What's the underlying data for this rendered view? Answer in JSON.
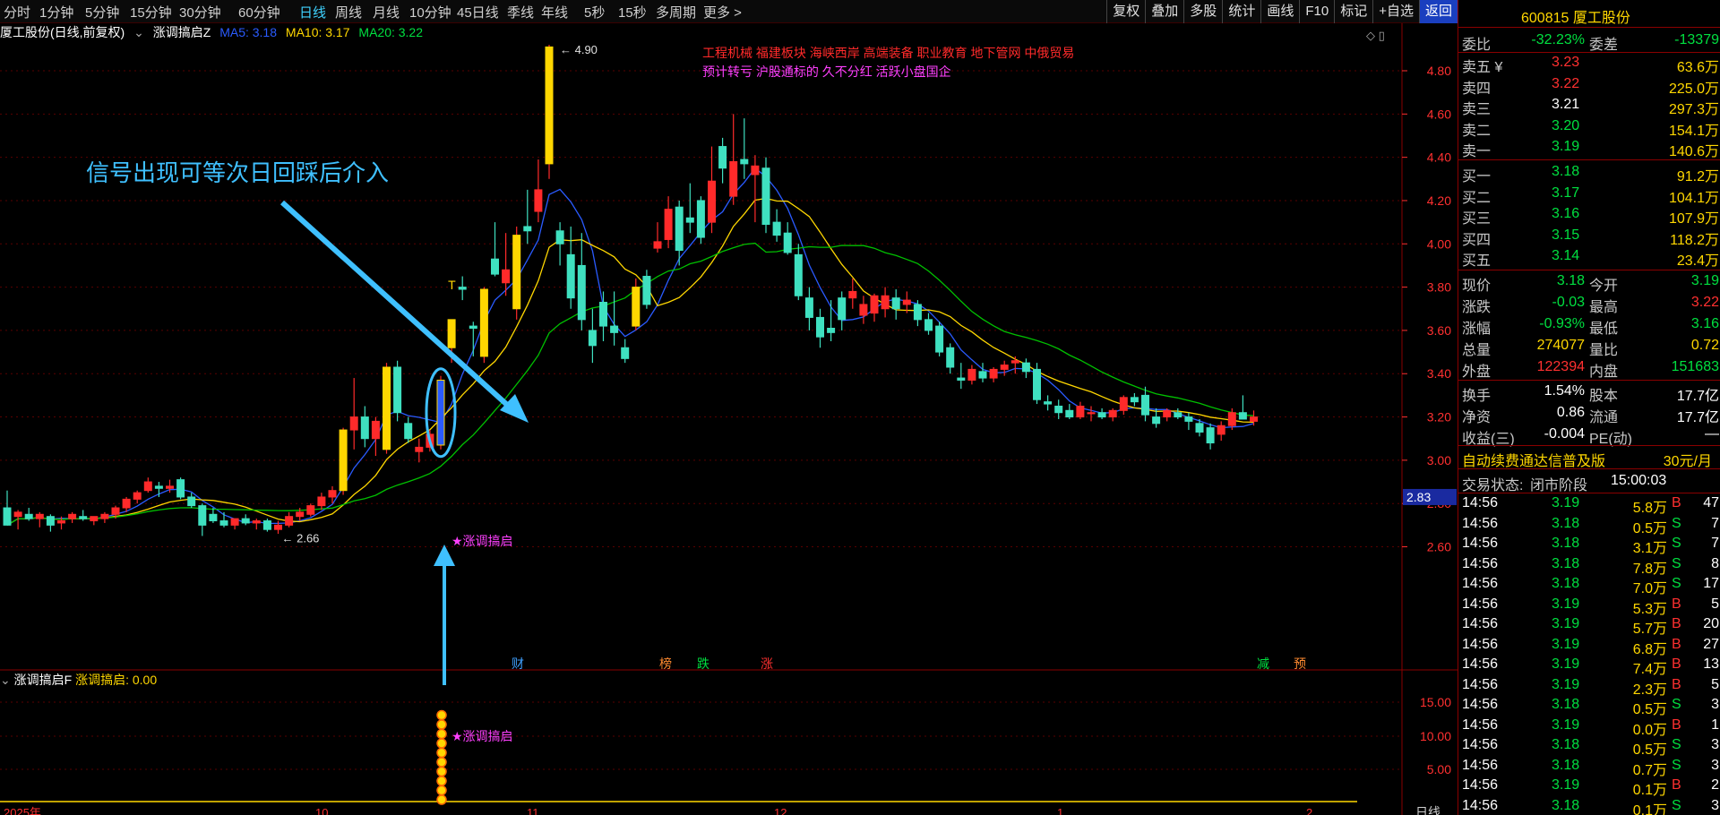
{
  "toolbar": {
    "periods": [
      "分时",
      "1分钟",
      "5分钟",
      "15分钟",
      "30分钟",
      "60分钟",
      "日线",
      "周线",
      "月线",
      "10分钟",
      "45日线",
      "季线",
      "年线",
      "5秒",
      "15秒",
      "多周期",
      "更多 >"
    ],
    "active_period": "日线",
    "tools": [
      "复权",
      "叠加",
      "多股",
      "统计",
      "画线",
      "F10",
      "标记",
      "+自选",
      "返回"
    ]
  },
  "chart": {
    "header": {
      "title": "厦工股份(日线,前复权)",
      "indicator": "涨调搞启Z",
      "ma5": "MA5: 3.18",
      "ma10": "MA10: 3.17",
      "ma20": "MA20: 3.22"
    },
    "annotation": "信号出现可等次日回踩后介入",
    "signal_label": "★涨调搞启",
    "max_label": "4.90",
    "min_label": "2.66",
    "concepts_line1": "工程机械   福建板块   海峡西岸 高端装备 职业教育 地下管网 中俄贸易",
    "concepts_line2": "预计转亏 沪股通标的 久不分红 活跃小盘国企",
    "markers": [
      "财",
      "榜",
      "跌",
      "涨",
      "减",
      "预"
    ],
    "current_price_tag": "2.83",
    "t_mark": "T",
    "x_labels": [
      "2025年",
      "10",
      "11",
      "12",
      "1",
      "2"
    ],
    "period_tag": "日线",
    "sub": {
      "title": "涨调搞启F",
      "value": "涨调搞启: 0.00",
      "signal_label": "★涨调搞启",
      "y_ticks": [
        "15.00",
        "10.00",
        "5.00"
      ]
    }
  },
  "chart_data": {
    "type": "candlestick",
    "y_ticks": [
      "4.80",
      "4.60",
      "4.40",
      "4.20",
      "4.00",
      "3.80",
      "3.60",
      "3.40",
      "3.20",
      "3.00",
      "2.80",
      "2.60"
    ],
    "ylim": [
      2.52,
      4.95
    ],
    "candles": [
      [
        2.78,
        2.86,
        2.7,
        2.7
      ],
      [
        2.74,
        2.77,
        2.68,
        2.76
      ],
      [
        2.75,
        2.78,
        2.72,
        2.73
      ],
      [
        2.73,
        2.76,
        2.69,
        2.75
      ],
      [
        2.74,
        2.75,
        2.67,
        2.7
      ],
      [
        2.71,
        2.74,
        2.68,
        2.72
      ],
      [
        2.73,
        2.76,
        2.71,
        2.75
      ],
      [
        2.74,
        2.77,
        2.72,
        2.73
      ],
      [
        2.72,
        2.74,
        2.7,
        2.74
      ],
      [
        2.73,
        2.76,
        2.71,
        2.75
      ],
      [
        2.75,
        2.79,
        2.73,
        2.78
      ],
      [
        2.78,
        2.83,
        2.76,
        2.82
      ],
      [
        2.82,
        2.86,
        2.8,
        2.85
      ],
      [
        2.86,
        2.92,
        2.85,
        2.9
      ],
      [
        2.88,
        2.9,
        2.83,
        2.87
      ],
      [
        2.87,
        2.91,
        2.85,
        2.88
      ],
      [
        2.91,
        2.92,
        2.82,
        2.83
      ],
      [
        2.83,
        2.85,
        2.78,
        2.79
      ],
      [
        2.79,
        2.8,
        2.65,
        2.7
      ],
      [
        2.75,
        2.78,
        2.71,
        2.72
      ],
      [
        2.72,
        2.76,
        2.69,
        2.7
      ],
      [
        2.7,
        2.73,
        2.68,
        2.73
      ],
      [
        2.73,
        2.75,
        2.7,
        2.71
      ],
      [
        2.71,
        2.73,
        2.68,
        2.72
      ],
      [
        2.72,
        2.73,
        2.67,
        2.68
      ],
      [
        2.68,
        2.72,
        2.66,
        2.7
      ],
      [
        2.7,
        2.76,
        2.69,
        2.74
      ],
      [
        2.74,
        2.78,
        2.72,
        2.76
      ],
      [
        2.75,
        2.8,
        2.74,
        2.79
      ],
      [
        2.79,
        2.85,
        2.77,
        2.83
      ],
      [
        2.83,
        2.88,
        2.8,
        2.86
      ],
      [
        2.86,
        3.15,
        2.84,
        3.14
      ],
      [
        3.14,
        3.38,
        3.05,
        3.2
      ],
      [
        3.2,
        3.25,
        3.06,
        3.1
      ],
      [
        3.1,
        3.2,
        3.02,
        3.18
      ],
      [
        3.05,
        3.45,
        3.03,
        3.43
      ],
      [
        3.43,
        3.46,
        3.18,
        3.22
      ],
      [
        3.17,
        3.2,
        3.08,
        3.1
      ],
      [
        3.04,
        3.1,
        2.99,
        3.06
      ],
      [
        3.06,
        3.14,
        3.04,
        3.12
      ],
      [
        3.07,
        3.39,
        3.05,
        3.37
      ],
      [
        3.52,
        3.62,
        3.45,
        3.65
      ],
      [
        3.8,
        3.85,
        3.74,
        3.79
      ],
      [
        3.62,
        3.64,
        3.48,
        3.61
      ],
      [
        3.48,
        3.8,
        3.45,
        3.79
      ],
      [
        3.93,
        4.1,
        3.85,
        3.86
      ],
      [
        3.82,
        4.05,
        3.76,
        3.88
      ],
      [
        3.7,
        4.08,
        3.65,
        4.04
      ],
      [
        4.08,
        4.25,
        4.0,
        4.06
      ],
      [
        4.15,
        4.39,
        4.1,
        4.25
      ],
      [
        4.37,
        4.92,
        4.3,
        4.91
      ],
      [
        4.06,
        4.1,
        3.9,
        4.0
      ],
      [
        3.95,
        4.08,
        3.7,
        3.75
      ],
      [
        3.9,
        4.05,
        3.6,
        3.65
      ],
      [
        3.6,
        3.7,
        3.45,
        3.53
      ],
      [
        3.73,
        3.78,
        3.55,
        3.62
      ],
      [
        3.62,
        3.78,
        3.53,
        3.59
      ],
      [
        3.52,
        3.56,
        3.45,
        3.47
      ],
      [
        3.62,
        3.84,
        3.6,
        3.8
      ],
      [
        3.85,
        3.88,
        3.7,
        3.72
      ],
      [
        3.98,
        4.1,
        3.96,
        4.01
      ],
      [
        4.02,
        4.22,
        3.98,
        4.16
      ],
      [
        4.17,
        4.2,
        3.9,
        3.97
      ],
      [
        4.12,
        4.28,
        4.05,
        4.1
      ],
      [
        4.2,
        4.22,
        4.0,
        4.03
      ],
      [
        4.1,
        4.45,
        4.05,
        4.29
      ],
      [
        4.45,
        4.49,
        4.28,
        4.35
      ],
      [
        4.22,
        4.6,
        4.18,
        4.38
      ],
      [
        4.39,
        4.58,
        4.3,
        4.37
      ],
      [
        4.32,
        4.41,
        4.1,
        4.36
      ],
      [
        4.35,
        4.4,
        4.05,
        4.09
      ],
      [
        4.1,
        4.16,
        4.01,
        4.04
      ],
      [
        4.05,
        4.1,
        3.95,
        3.96
      ],
      [
        3.95,
        4.0,
        3.74,
        3.76
      ],
      [
        3.75,
        3.8,
        3.6,
        3.66
      ],
      [
        3.66,
        3.7,
        3.52,
        3.57
      ],
      [
        3.61,
        3.74,
        3.55,
        3.59
      ],
      [
        3.75,
        3.78,
        3.6,
        3.65
      ],
      [
        3.75,
        3.84,
        3.7,
        3.78
      ],
      [
        3.67,
        3.76,
        3.63,
        3.72
      ],
      [
        3.68,
        3.77,
        3.64,
        3.76
      ],
      [
        3.7,
        3.8,
        3.66,
        3.76
      ],
      [
        3.75,
        3.79,
        3.65,
        3.7
      ],
      [
        3.72,
        3.78,
        3.68,
        3.74
      ],
      [
        3.72,
        3.74,
        3.62,
        3.65
      ],
      [
        3.65,
        3.68,
        3.58,
        3.6
      ],
      [
        3.62,
        3.64,
        3.48,
        3.5
      ],
      [
        3.52,
        3.54,
        3.4,
        3.43
      ],
      [
        3.38,
        3.45,
        3.33,
        3.37
      ],
      [
        3.37,
        3.44,
        3.35,
        3.42
      ],
      [
        3.41,
        3.45,
        3.36,
        3.38
      ],
      [
        3.38,
        3.43,
        3.36,
        3.42
      ],
      [
        3.42,
        3.46,
        3.39,
        3.44
      ],
      [
        3.45,
        3.48,
        3.4,
        3.46
      ],
      [
        3.45,
        3.47,
        3.38,
        3.41
      ],
      [
        3.42,
        3.45,
        3.26,
        3.28
      ],
      [
        3.27,
        3.3,
        3.23,
        3.26
      ],
      [
        3.25,
        3.28,
        3.19,
        3.22
      ],
      [
        3.23,
        3.26,
        3.19,
        3.2
      ],
      [
        3.2,
        3.27,
        3.19,
        3.25
      ],
      [
        3.22,
        3.25,
        3.18,
        3.22
      ],
      [
        3.22,
        3.24,
        3.19,
        3.2
      ],
      [
        3.2,
        3.24,
        3.18,
        3.23
      ],
      [
        3.23,
        3.3,
        3.21,
        3.29
      ],
      [
        3.29,
        3.31,
        3.25,
        3.27
      ],
      [
        3.3,
        3.34,
        3.18,
        3.21
      ],
      [
        3.2,
        3.24,
        3.15,
        3.17
      ],
      [
        3.2,
        3.24,
        3.18,
        3.23
      ],
      [
        3.22,
        3.24,
        3.19,
        3.2
      ],
      [
        3.2,
        3.22,
        3.14,
        3.18
      ],
      [
        3.17,
        3.19,
        3.11,
        3.13
      ],
      [
        3.15,
        3.17,
        3.05,
        3.08
      ],
      [
        3.12,
        3.18,
        3.09,
        3.16
      ],
      [
        3.16,
        3.24,
        3.14,
        3.22
      ],
      [
        3.22,
        3.3,
        3.19,
        3.19
      ],
      [
        3.18,
        3.23,
        3.16,
        3.2
      ]
    ]
  },
  "quote": {
    "code": "600815",
    "name": "厦工股份",
    "weibi_label": "委比",
    "weibi": "-32.23%",
    "weicha_label": "委差",
    "weicha": "-13379",
    "sell": [
      {
        "label": "卖五 ¥",
        "price": "3.23",
        "vol": "63.6万"
      },
      {
        "label": "卖四",
        "price": "3.22",
        "vol": "225.0万"
      },
      {
        "label": "卖三",
        "price": "3.21",
        "vol": "297.3万"
      },
      {
        "label": "卖二",
        "price": "3.20",
        "vol": "154.1万"
      },
      {
        "label": "卖一",
        "price": "3.19",
        "vol": "140.6万"
      }
    ],
    "buy": [
      {
        "label": "买一",
        "price": "3.18",
        "vol": "91.2万"
      },
      {
        "label": "买二",
        "price": "3.17",
        "vol": "104.1万"
      },
      {
        "label": "买三",
        "price": "3.16",
        "vol": "107.9万"
      },
      {
        "label": "买四",
        "price": "3.15",
        "vol": "118.2万"
      },
      {
        "label": "买五",
        "price": "3.14",
        "vol": "23.4万"
      }
    ],
    "stats": [
      {
        "l1": "现价",
        "v1": "3.18",
        "l2": "今开",
        "v2": "3.19"
      },
      {
        "l1": "涨跌",
        "v1": "-0.03",
        "l2": "最高",
        "v2": "3.22"
      },
      {
        "l1": "涨幅",
        "v1": "-0.93%",
        "l2": "最低",
        "v2": "3.16"
      },
      {
        "l1": "总量",
        "v1": "274077",
        "l2": "量比",
        "v2": "0.72"
      },
      {
        "l1": "外盘",
        "v1": "122394",
        "l2": "内盘",
        "v2": "151683"
      }
    ],
    "stats2": [
      {
        "l1": "换手",
        "v1": "1.54%",
        "l2": "股本",
        "v2": "17.7亿"
      },
      {
        "l1": "净资",
        "v1": "0.86",
        "l2": "流通",
        "v2": "17.7亿"
      },
      {
        "l1": "收益(三)",
        "v1": "-0.004",
        "l2": "PE(动)",
        "v2": "—"
      }
    ],
    "promo": "自动续费通达信普及版",
    "promo_price": "30元/月",
    "status_label": "交易状态:",
    "status": "闭市阶段",
    "status_time": "15:00:03",
    "ticks": [
      {
        "t": "14:56",
        "p": "3.19",
        "v": "5.8万",
        "d": "B",
        "n": "47"
      },
      {
        "t": "14:56",
        "p": "3.18",
        "v": "0.5万",
        "d": "S",
        "n": "7"
      },
      {
        "t": "14:56",
        "p": "3.18",
        "v": "3.1万",
        "d": "S",
        "n": "7"
      },
      {
        "t": "14:56",
        "p": "3.18",
        "v": "7.8万",
        "d": "S",
        "n": "8"
      },
      {
        "t": "14:56",
        "p": "3.18",
        "v": "7.0万",
        "d": "S",
        "n": "17"
      },
      {
        "t": "14:56",
        "p": "3.19",
        "v": "5.3万",
        "d": "B",
        "n": "5"
      },
      {
        "t": "14:56",
        "p": "3.19",
        "v": "5.7万",
        "d": "B",
        "n": "20"
      },
      {
        "t": "14:56",
        "p": "3.19",
        "v": "6.8万",
        "d": "B",
        "n": "27"
      },
      {
        "t": "14:56",
        "p": "3.19",
        "v": "7.4万",
        "d": "B",
        "n": "13"
      },
      {
        "t": "14:56",
        "p": "3.19",
        "v": "2.3万",
        "d": "B",
        "n": "5"
      },
      {
        "t": "14:56",
        "p": "3.18",
        "v": "0.5万",
        "d": "S",
        "n": "3"
      },
      {
        "t": "14:56",
        "p": "3.19",
        "v": "0.0万",
        "d": "B",
        "n": "1"
      },
      {
        "t": "14:56",
        "p": "3.18",
        "v": "0.5万",
        "d": "S",
        "n": "3"
      },
      {
        "t": "14:56",
        "p": "3.18",
        "v": "0.7万",
        "d": "S",
        "n": "3"
      },
      {
        "t": "14:56",
        "p": "3.19",
        "v": "0.1万",
        "d": "B",
        "n": "2"
      },
      {
        "t": "14:56",
        "p": "3.18",
        "v": "0.1万",
        "d": "S",
        "n": "3"
      }
    ]
  }
}
